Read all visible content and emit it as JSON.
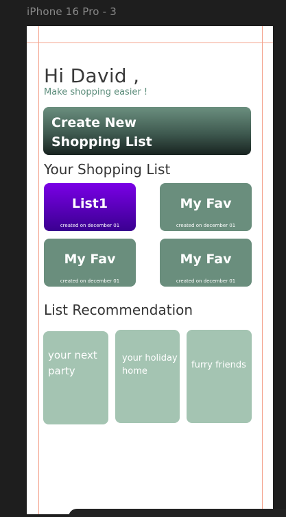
{
  "frame": {
    "title": "iPhone 16 Pro - 3"
  },
  "header": {
    "greeting": "Hi David ,",
    "subtitle": "Make shopping easier !"
  },
  "create_button": {
    "label": "Create New\nShopping List"
  },
  "shopping_lists": {
    "title": "Your Shopping List",
    "items": [
      {
        "name": "List1",
        "created": "created on december 01",
        "color": "#6a00d8"
      },
      {
        "name": "My Fav",
        "created": "created on december 01",
        "color": "#6a8e7d"
      },
      {
        "name": "My Fav",
        "created": "created on december 01",
        "color": "#6a8e7d"
      },
      {
        "name": "My Fav",
        "created": "created on december 01",
        "color": "#6a8e7d"
      }
    ]
  },
  "recommendations": {
    "title": "List Recommendation",
    "items": [
      {
        "label": "your next\n party"
      },
      {
        "label": "your holiday\n home"
      },
      {
        "label": "furry friends"
      }
    ]
  },
  "colors": {
    "accent_green": "#6a8e7d",
    "light_green": "#a4c4b2",
    "purple": "#6a00d8"
  }
}
